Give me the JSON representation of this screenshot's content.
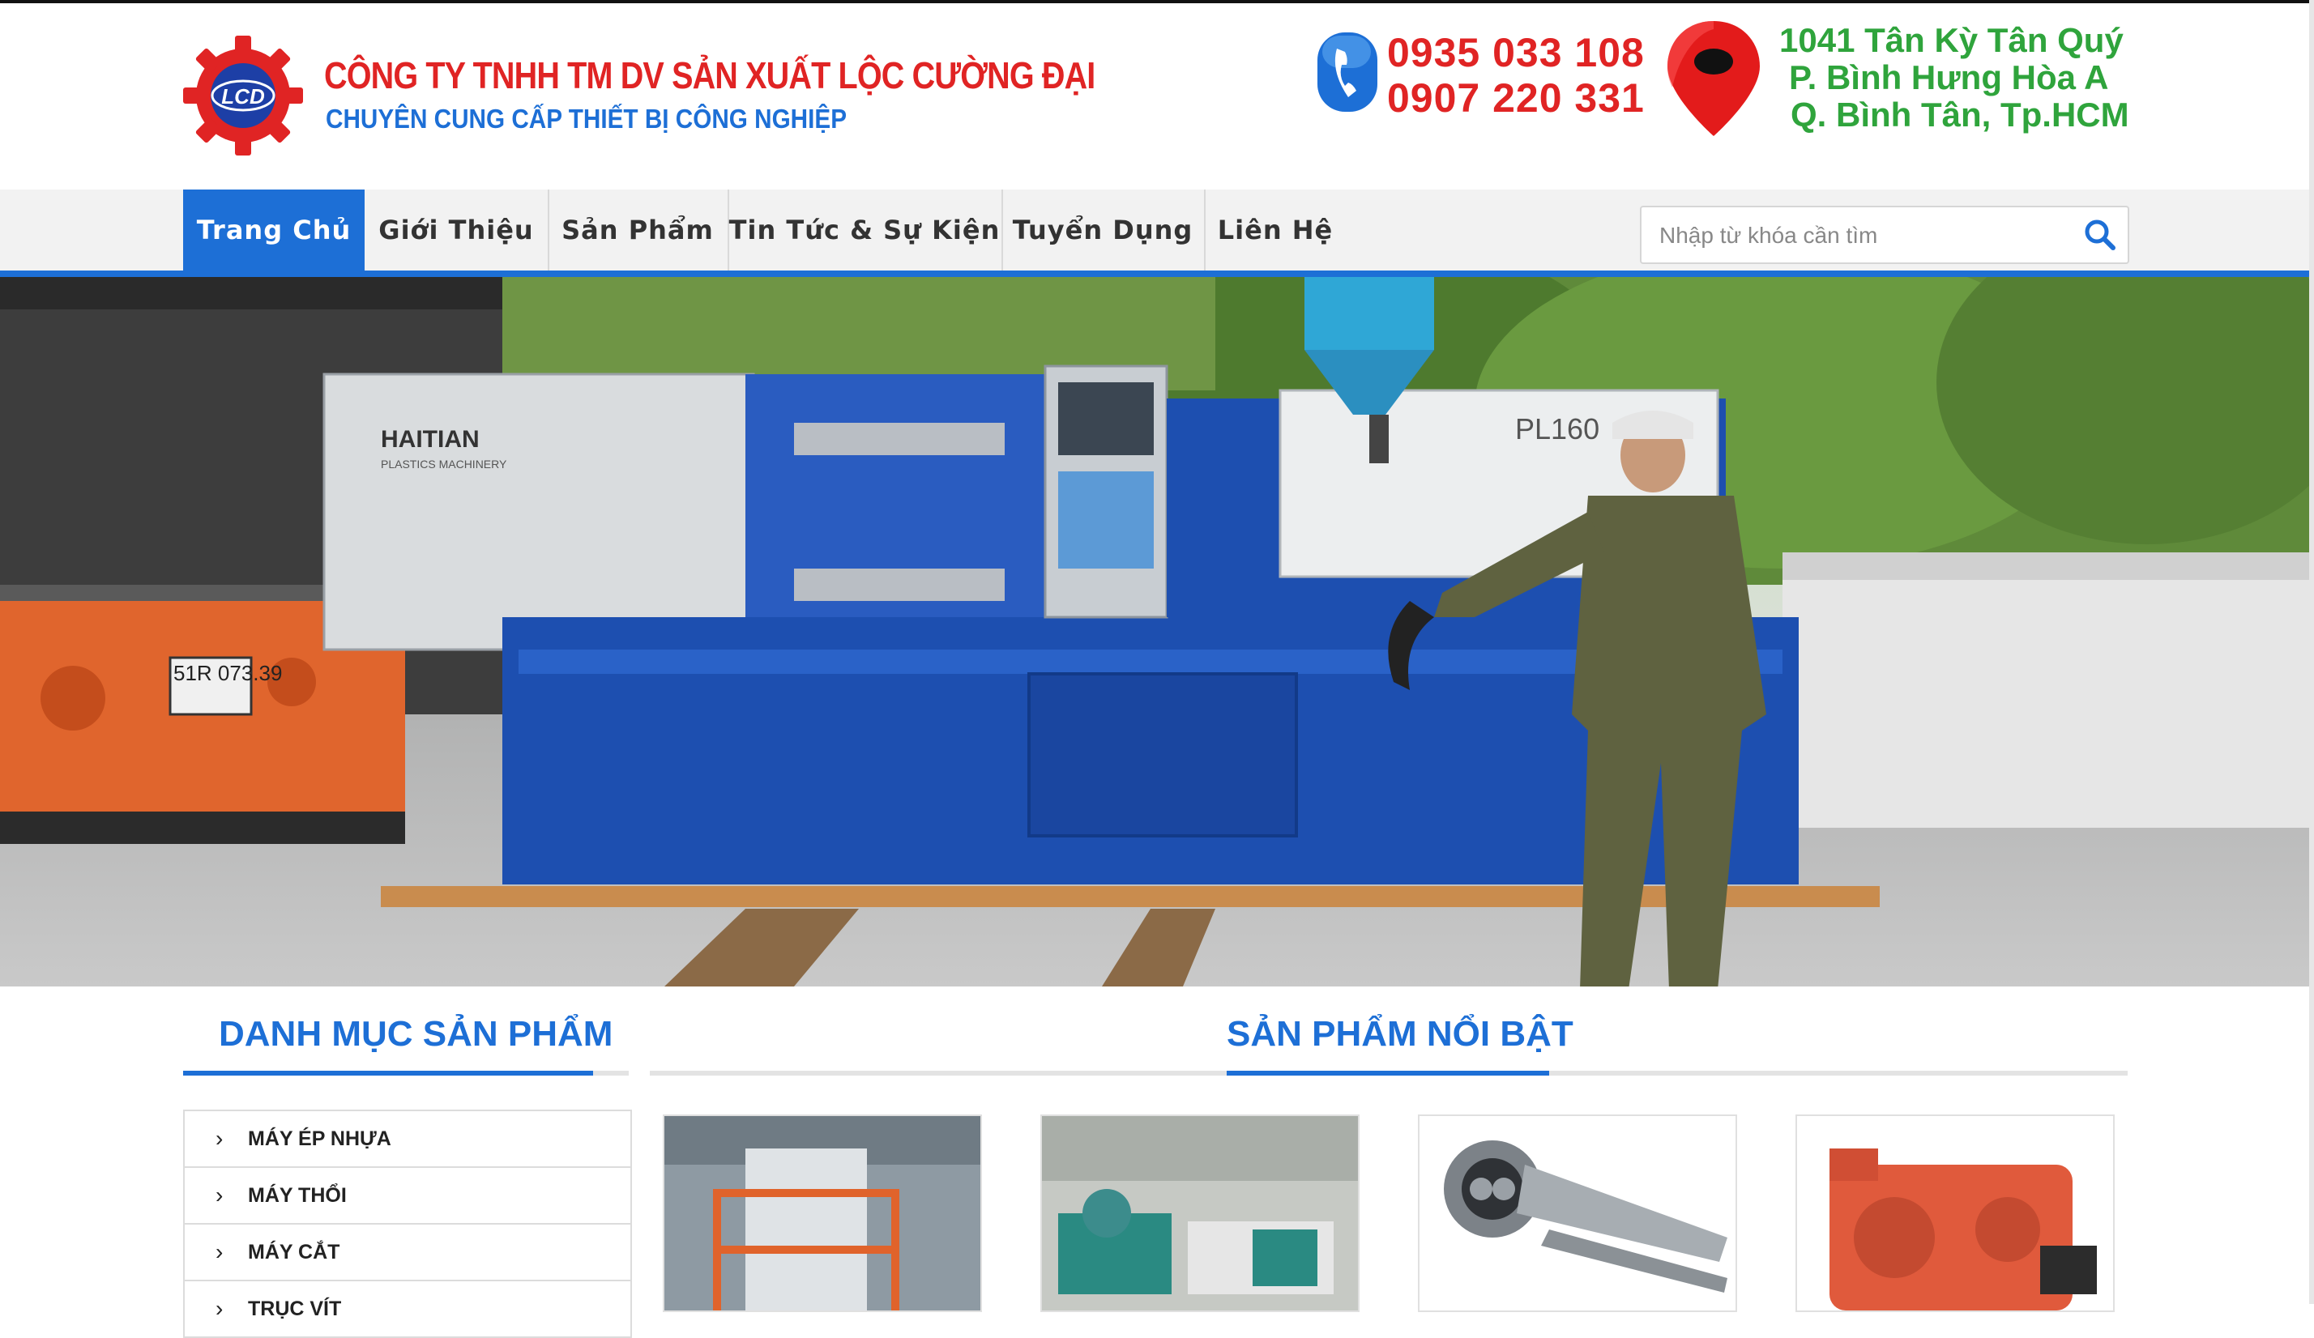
{
  "header": {
    "logo_text": "LCD",
    "company_name": "CÔNG TY TNHH TM DV SẢN XUẤT LỘC CƯỜNG ĐẠI",
    "slogan": "CHUYÊN CUNG CẤP THIẾT BỊ CÔNG NGHIỆP",
    "phones": [
      "0935 033 108",
      "0907 220 331"
    ],
    "address_lines": [
      "1041 Tân Kỳ Tân Quý",
      "P. Bình Hưng Hòa A",
      "Q. Bình Tân, Tp.HCM"
    ]
  },
  "nav": {
    "items": [
      "Trang Chủ",
      "Giới Thiệu",
      "Sản Phẩm",
      "Tin Tức & Sự Kiện",
      "Tuyển Dụng",
      "Liên Hệ"
    ],
    "active": "Trang Chủ"
  },
  "search": {
    "placeholder": "Nhập từ khóa cần tìm",
    "value": ""
  },
  "banner": {
    "machine_brand": "HAITIAN",
    "machine_sub": "PLASTICS MACHINERY",
    "machine_model": "PL160",
    "truck_plate": "51R 073.39"
  },
  "sidebar": {
    "title": "DANH MỤC SẢN PHẨM",
    "items": [
      "MÁY ÉP NHỰA",
      "MÁY THỔI",
      "MÁY CẮT",
      "TRỤC VÍT"
    ]
  },
  "featured": {
    "title": "SẢN PHẨM NỔI BẬT"
  },
  "colors": {
    "primary_blue": "#1d6fd6",
    "brand_red": "#e02424",
    "address_green": "#2fa43c",
    "nav_bg": "#f2f2f2"
  }
}
